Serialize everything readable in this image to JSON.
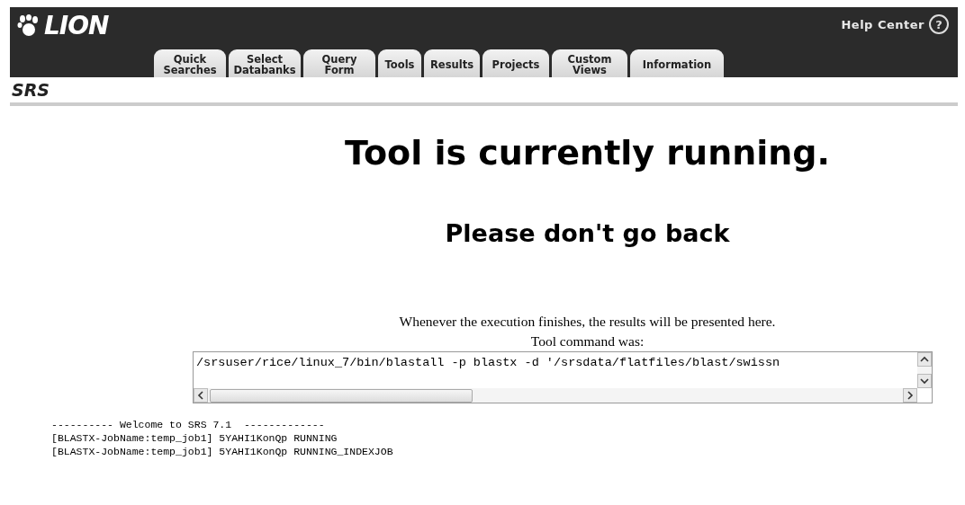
{
  "header": {
    "logo": "LION",
    "help": "Help Center",
    "help_icon": "?"
  },
  "tabs": [
    {
      "label": "Quick\nSearches"
    },
    {
      "label": "Select\nDatabanks"
    },
    {
      "label": "Query\nForm"
    },
    {
      "label": "Tools"
    },
    {
      "label": "Results"
    },
    {
      "label": "Projects"
    },
    {
      "label": "Custom\nViews"
    },
    {
      "label": "Information"
    }
  ],
  "section_title": "SRS",
  "heading": "Tool is currently running.",
  "subheading": "Please don't go back",
  "message": "Whenever the execution finishes, the results will be presented here.",
  "command_label": "Tool command was:",
  "command": "/srsuser/rice/linux_7/bin/blastall -p blastx -d '/srsdata/flatfiles/blast/swissn",
  "log": [
    "---------- Welcome to SRS 7.1  -------------",
    "[BLASTX-JobName:temp_job1] 5YAHI1KonQp RUNNING",
    "[BLASTX-JobName:temp_job1] 5YAHI1KonQp RUNNING_INDEXJOB"
  ]
}
